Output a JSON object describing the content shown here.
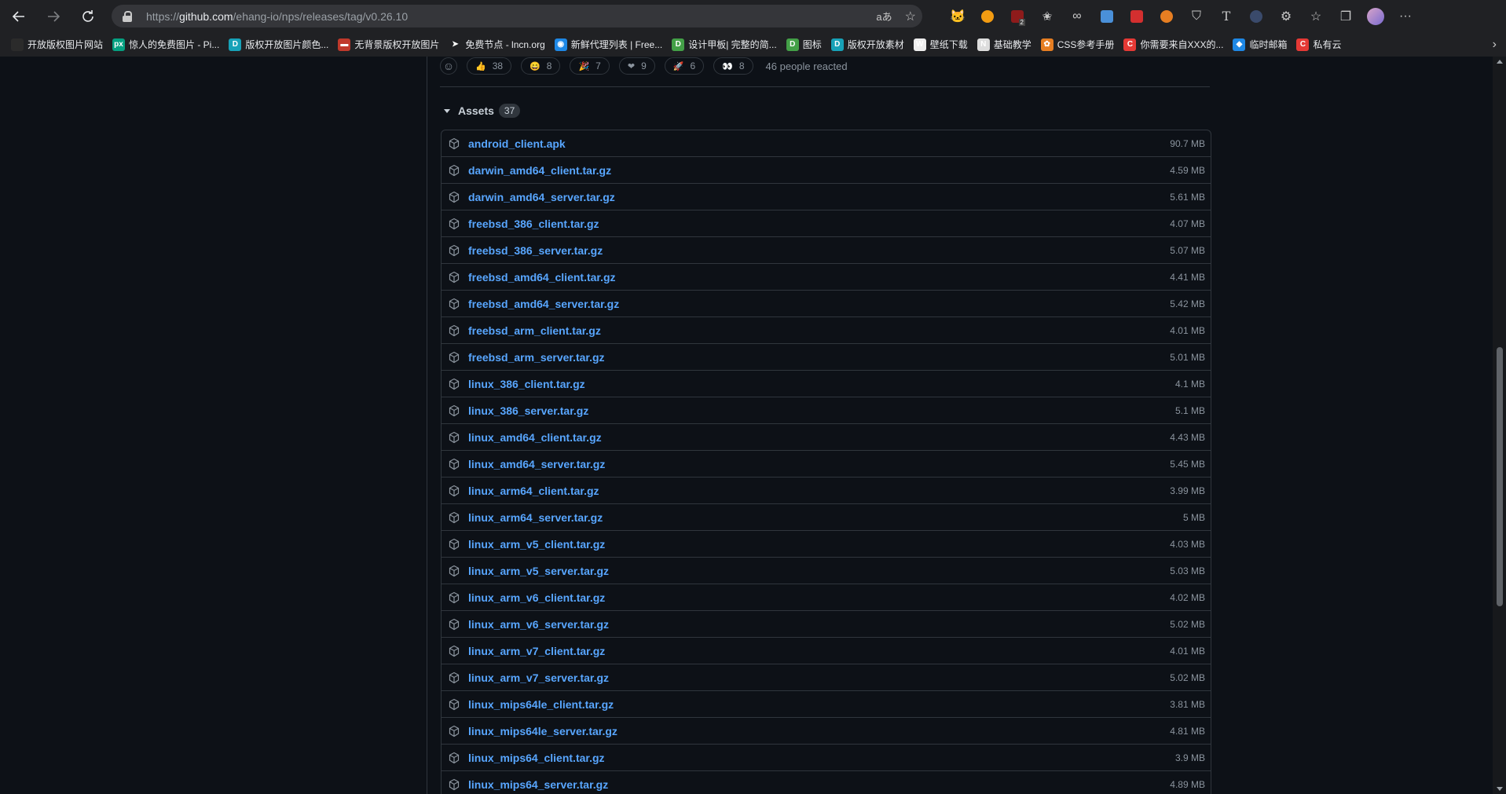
{
  "browser": {
    "url_scheme": "https://",
    "url_host": "github.com",
    "url_path": "/ehang-io/nps/releases/tag/v0.26.10",
    "translate_icon": "translate-icon",
    "favorite_icon": "star-add-icon",
    "extension_icons": [
      "cat-icon",
      "bird-icon",
      "ublock-icon",
      "star-icon",
      "infinity-icon",
      "image-icon",
      "red-square-icon",
      "fox-icon",
      "shield-icon",
      "text-t-icon",
      "cursor-icon",
      "puzzle-icon",
      "favorites-icon",
      "collections-icon",
      "avatar",
      "more-icon"
    ],
    "ublock_badge": "2"
  },
  "bookmarks": [
    {
      "label": "开放版权图片网站",
      "color": "#2b2b2b",
      "glyph": ""
    },
    {
      "label": "惊人的免费图片 - Pi...",
      "color": "#05a081",
      "glyph": "px"
    },
    {
      "label": "版权开放图片颜色...",
      "color": "#17a2b8",
      "glyph": "D"
    },
    {
      "label": "无背景版权开放图片",
      "color": "#c0392b",
      "glyph": "▬"
    },
    {
      "label": "免费节点 - lncn.org",
      "color": "#202124",
      "glyph": "➤"
    },
    {
      "label": "新鲜代理列表 | Free...",
      "color": "#1e88e5",
      "glyph": "◉"
    },
    {
      "label": "设计甲板| 完整的简...",
      "color": "#43a047",
      "glyph": "D"
    },
    {
      "label": "图标",
      "color": "#43a047",
      "glyph": "D"
    },
    {
      "label": "版权开放素材",
      "color": "#17a2b8",
      "glyph": "D"
    },
    {
      "label": "壁纸下载",
      "color": "#eeeeee",
      "glyph": "W"
    },
    {
      "label": "基础教学",
      "color": "#dddddd",
      "glyph": "N"
    },
    {
      "label": "CSS参考手册",
      "color": "#e67e22",
      "glyph": "✿"
    },
    {
      "label": "你需要来自XXX的...",
      "color": "#e53935",
      "glyph": "C"
    },
    {
      "label": "临时邮箱",
      "color": "#1e88e5",
      "glyph": "◆"
    },
    {
      "label": "私有云",
      "color": "#e53935",
      "glyph": "C"
    }
  ],
  "reactions": {
    "items": [
      {
        "emoji": "👍",
        "count": "38"
      },
      {
        "emoji": "😄",
        "count": "8"
      },
      {
        "emoji": "🎉",
        "count": "7"
      },
      {
        "emoji": "❤",
        "count": "9"
      },
      {
        "emoji": "🚀",
        "count": "6"
      },
      {
        "emoji": "👀",
        "count": "8"
      }
    ],
    "summary": "46 people reacted"
  },
  "assets": {
    "title": "Assets",
    "count": "37",
    "items": [
      {
        "name": "android_client.apk",
        "size": "90.7 MB"
      },
      {
        "name": "darwin_amd64_client.tar.gz",
        "size": "4.59 MB"
      },
      {
        "name": "darwin_amd64_server.tar.gz",
        "size": "5.61 MB"
      },
      {
        "name": "freebsd_386_client.tar.gz",
        "size": "4.07 MB"
      },
      {
        "name": "freebsd_386_server.tar.gz",
        "size": "5.07 MB"
      },
      {
        "name": "freebsd_amd64_client.tar.gz",
        "size": "4.41 MB"
      },
      {
        "name": "freebsd_amd64_server.tar.gz",
        "size": "5.42 MB"
      },
      {
        "name": "freebsd_arm_client.tar.gz",
        "size": "4.01 MB"
      },
      {
        "name": "freebsd_arm_server.tar.gz",
        "size": "5.01 MB"
      },
      {
        "name": "linux_386_client.tar.gz",
        "size": "4.1 MB"
      },
      {
        "name": "linux_386_server.tar.gz",
        "size": "5.1 MB"
      },
      {
        "name": "linux_amd64_client.tar.gz",
        "size": "4.43 MB"
      },
      {
        "name": "linux_amd64_server.tar.gz",
        "size": "5.45 MB"
      },
      {
        "name": "linux_arm64_client.tar.gz",
        "size": "3.99 MB"
      },
      {
        "name": "linux_arm64_server.tar.gz",
        "size": "5 MB"
      },
      {
        "name": "linux_arm_v5_client.tar.gz",
        "size": "4.03 MB"
      },
      {
        "name": "linux_arm_v5_server.tar.gz",
        "size": "5.03 MB"
      },
      {
        "name": "linux_arm_v6_client.tar.gz",
        "size": "4.02 MB"
      },
      {
        "name": "linux_arm_v6_server.tar.gz",
        "size": "5.02 MB"
      },
      {
        "name": "linux_arm_v7_client.tar.gz",
        "size": "4.01 MB"
      },
      {
        "name": "linux_arm_v7_server.tar.gz",
        "size": "5.02 MB"
      },
      {
        "name": "linux_mips64le_client.tar.gz",
        "size": "3.81 MB"
      },
      {
        "name": "linux_mips64le_server.tar.gz",
        "size": "4.81 MB"
      },
      {
        "name": "linux_mips64_client.tar.gz",
        "size": "3.9 MB"
      },
      {
        "name": "linux_mips64_server.tar.gz",
        "size": "4.89 MB"
      }
    ]
  },
  "colors": {
    "link": "#58a6ff",
    "muted": "#8b949e",
    "border": "#30363d",
    "background": "#0d1117"
  }
}
